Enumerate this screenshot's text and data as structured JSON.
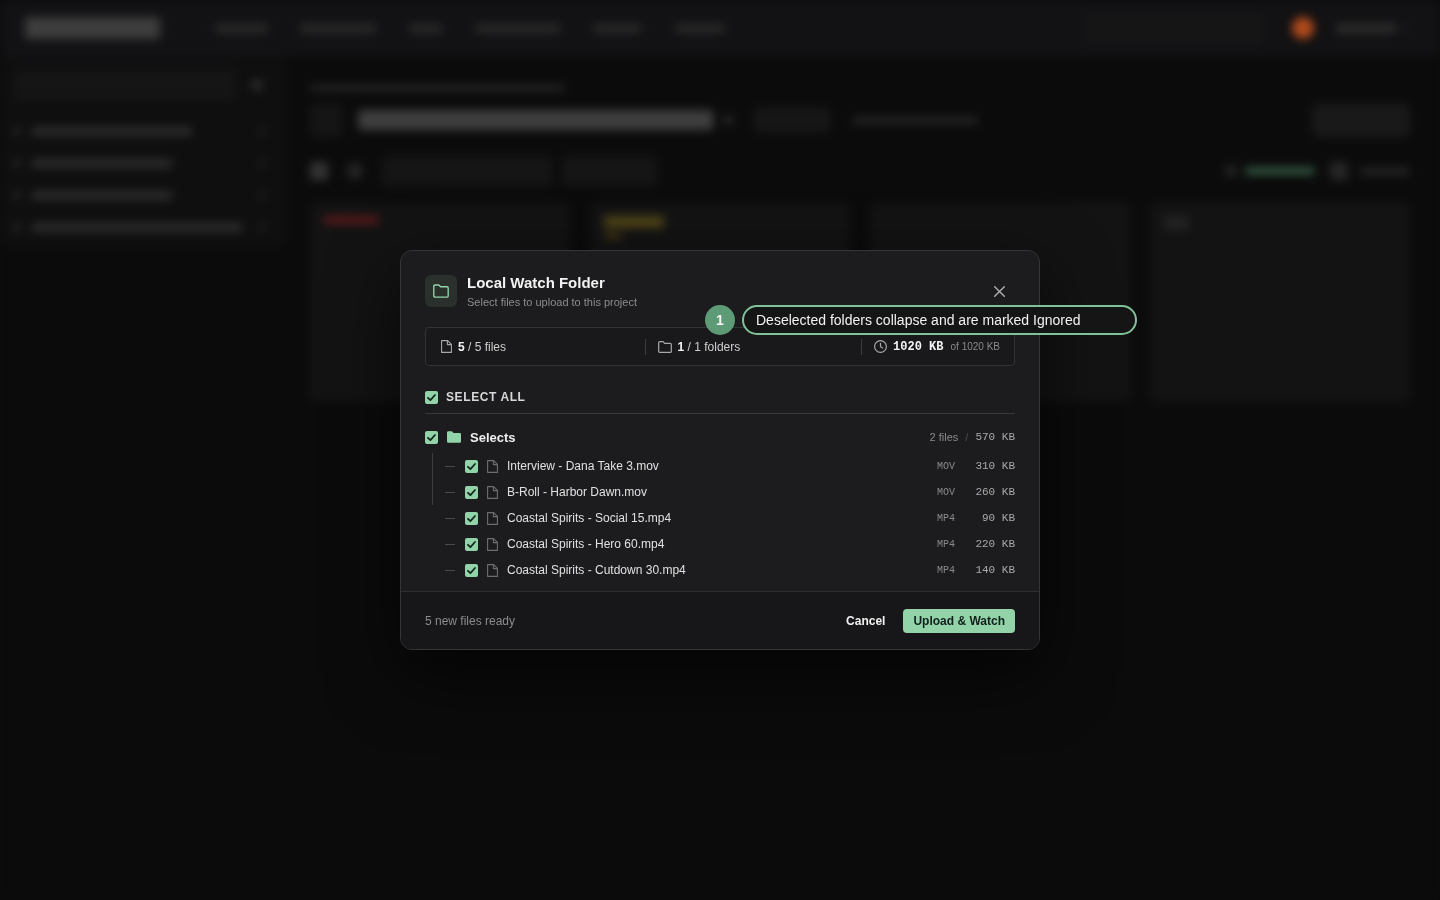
{
  "dialog": {
    "title": "Local Watch Folder",
    "subtitle": "Select files to upload to this project"
  },
  "summary": [
    {
      "kind": "files",
      "text": "**5** / 5 files"
    },
    {
      "kind": "folders",
      "text": "**1** / 1 folders"
    },
    {
      "kind": "size",
      "value": "1020 KB",
      "text": "of 1020 KB"
    }
  ],
  "select_all": {
    "label": "SELECT ALL",
    "checked": true
  },
  "tree": [
    {
      "kind": "folder",
      "name": "Selects",
      "checked": true,
      "count": "2 files",
      "separator": "/",
      "size": "570 KB",
      "children": [
        {
          "kind": "file",
          "name": "Interview - Dana Take 3.mov",
          "checked": true,
          "type": "MOV",
          "size": "310 KB"
        },
        {
          "kind": "file",
          "name": "B-Roll - Harbor Dawn.mov",
          "checked": true,
          "type": "MOV",
          "size": "260 KB"
        }
      ]
    },
    {
      "kind": "file",
      "name": "Coastal Spirits - Social 15.mp4",
      "checked": true,
      "type": "MP4",
      "size": "90 KB"
    },
    {
      "kind": "file",
      "name": "Coastal Spirits - Hero 60.mp4",
      "checked": true,
      "type": "MP4",
      "size": "220 KB"
    },
    {
      "kind": "file",
      "name": "Coastal Spirits - Cutdown 30.mp4",
      "checked": true,
      "type": "MP4",
      "size": "140 KB"
    }
  ],
  "footer": {
    "status": "5 new files ready",
    "buttons": [
      {
        "label": "Cancel",
        "kind": "secondary"
      },
      {
        "label": "Upload & Watch",
        "kind": "primary"
      }
    ]
  },
  "callout": {
    "number": "1",
    "text": "Deselected folders collapse and are marked Ignored"
  }
}
